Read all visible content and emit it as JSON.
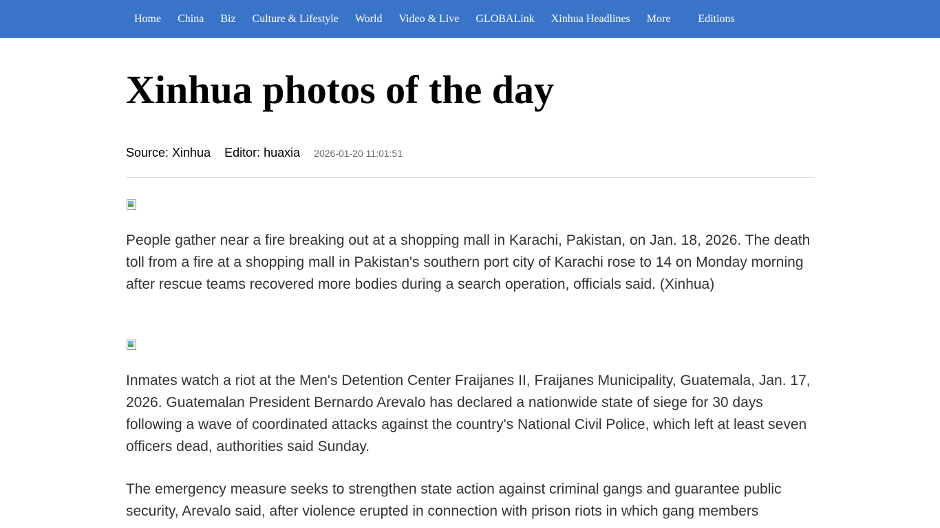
{
  "nav": {
    "items": [
      "Home",
      "China",
      "Biz",
      "Culture & Lifestyle",
      "World",
      "Video & Live",
      "GLOBALink",
      "Xinhua Headlines",
      "More",
      "Editions"
    ]
  },
  "article": {
    "title": "Xinhua photos of the day",
    "source": "Source: Xinhua",
    "editor": "Editor: huaxia",
    "date": "2026-01-20 11:01:51",
    "paragraphs": [
      "People gather near a fire breaking out at a shopping mall in Karachi, Pakistan, on Jan. 18, 2026. The death toll from a fire at a shopping mall in Pakistan's southern port city of Karachi rose to 14 on Monday morning after rescue teams recovered more bodies during a search operation, officials said. (Xinhua)",
      "Inmates watch a riot at the Men's Detention Center Fraijanes II, Fraijanes Municipality, Guatemala, Jan. 17, 2026. Guatemalan President Bernardo Arevalo has declared a nationwide state of siege for 30 days following a wave of coordinated attacks against the country's National Civil Police, which left at least seven officers dead, authorities said Sunday.",
      "The emergency measure seeks to strengthen state action against criminal gangs and guarantee public security, Arevalo said, after violence erupted in connection with prison riots in which gang members"
    ]
  },
  "icons": {
    "broken_image": "broken-image-icon"
  },
  "colors": {
    "nav_background": "#3a74c8",
    "nav_text": "#ffffff",
    "title": "#000000",
    "body_text": "#333333",
    "date_text": "#666666",
    "divider": "#d7d7d7"
  }
}
